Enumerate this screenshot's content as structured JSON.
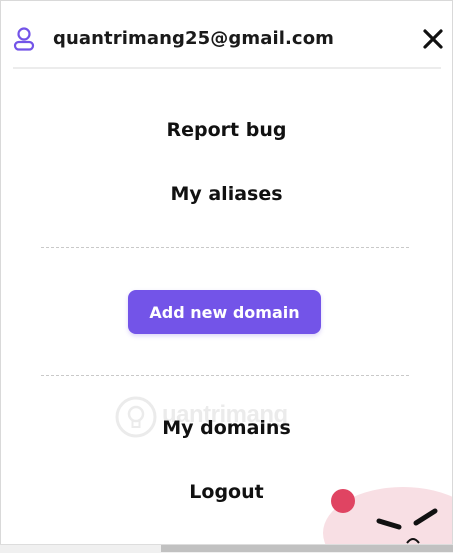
{
  "header": {
    "email": "quantrimang25@gmail.com"
  },
  "menu": {
    "report_bug": "Report bug",
    "my_aliases": "My aliases",
    "add_domain_label": "Add new domain",
    "my_domains": "My domains",
    "logout": "Logout"
  },
  "watermark": {
    "text": "uantrimang"
  },
  "colors": {
    "accent": "#7354e8",
    "text": "#111111",
    "divider": "#c9c9c9",
    "mascot": "#f7d6dc",
    "mascot_dot": "#e04462"
  },
  "icons": [
    "user-icon",
    "close-icon",
    "lightbulb-icon"
  ]
}
